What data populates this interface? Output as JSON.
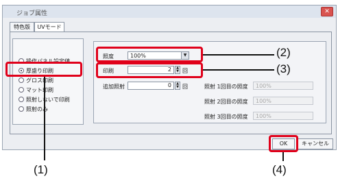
{
  "dialog": {
    "title": "ジョブ属性",
    "close_label": "✕",
    "tabs": [
      {
        "label": "特色版"
      },
      {
        "label": "UVモード"
      }
    ],
    "modes": [
      {
        "label": "操作パネル設定値",
        "selected": false
      },
      {
        "label": "厚盛り印刷",
        "selected": true
      },
      {
        "label": "グロス印刷",
        "selected": false
      },
      {
        "label": "マット印刷",
        "selected": false
      },
      {
        "label": "照射しないで印刷",
        "selected": false
      },
      {
        "label": "照射のみ",
        "selected": false
      }
    ],
    "illuminance": {
      "label": "照度",
      "value": "100%",
      "arrow": "▼"
    },
    "print": {
      "label": "印刷",
      "value": "2",
      "unit": "回"
    },
    "extra": {
      "label": "追加照射",
      "value": "0",
      "unit": "回"
    },
    "irradiation": [
      {
        "label": "照射 1回目の照度",
        "value": "100%"
      },
      {
        "label": "照射 2回目の照度",
        "value": "100%"
      },
      {
        "label": "照射 3回目の照度",
        "value": "100%"
      }
    ],
    "ok_label": "OK",
    "cancel_label": "キャンセル"
  },
  "callouts": [
    "(1)",
    "(2)",
    "(3)",
    "(4)"
  ],
  "colors": {
    "highlight": "#e0001a"
  }
}
